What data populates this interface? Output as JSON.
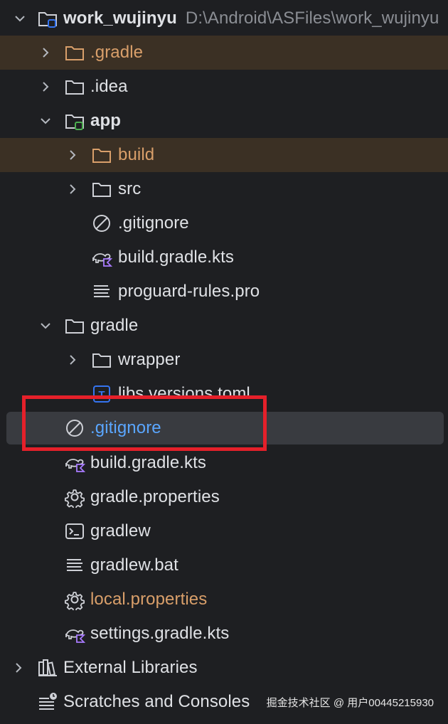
{
  "tree": {
    "root": {
      "name": "work_wujinyu",
      "path": "D:\\Android\\ASFiles\\work_wujinyu"
    },
    "gradle_dir": ".gradle",
    "idea_dir": ".idea",
    "app_dir": "app",
    "app_build": "build",
    "app_src": "src",
    "app_gitignore": ".gitignore",
    "app_build_gradle": "build.gradle.kts",
    "app_proguard": "proguard-rules.pro",
    "gradle_folder": "gradle",
    "wrapper": "wrapper",
    "libs_versions": "libs.versions.toml",
    "root_gitignore": ".gitignore",
    "root_build_gradle": "build.gradle.kts",
    "gradle_properties": "gradle.properties",
    "gradlew": "gradlew",
    "gradlew_bat": "gradlew.bat",
    "local_properties": "local.properties",
    "settings_gradle": "settings.gradle.kts",
    "external_libraries": "External Libraries",
    "scratches": "Scratches and Consoles"
  },
  "watermark": "掘金技术社区 @ 用户00445215930",
  "colors": {
    "background": "#1e1f22",
    "excluded": "#d99f6a",
    "selected": "#5aa6ff",
    "highlight_box": "#e5202a"
  }
}
